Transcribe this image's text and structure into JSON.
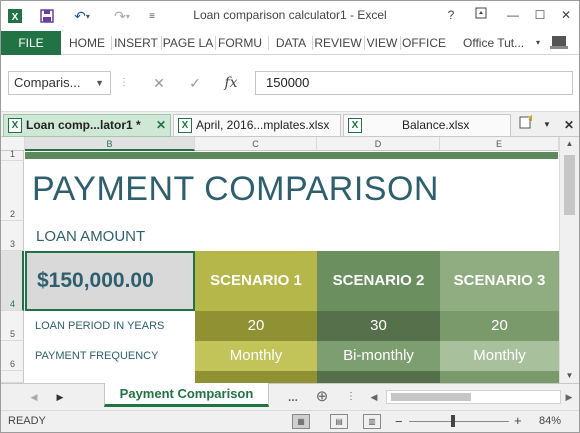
{
  "app": {
    "title": "Loan comparison calculator1 - Excel",
    "qat": {
      "save": "save-icon",
      "undo": "undo-icon",
      "redo": "redo-icon"
    },
    "window_buttons": {
      "help": "?",
      "restore_ribbon": "ribbon-icon",
      "minimize": "minimize-icon",
      "maximize": "maximize-icon",
      "close": "close-icon"
    }
  },
  "ribbon": {
    "file": "FILE",
    "tabs": [
      "HOME",
      "INSERT",
      "PAGE LA",
      "FORMU",
      "DATA",
      "REVIEW",
      "VIEW",
      "OFFICE"
    ],
    "account": "Office Tut..."
  },
  "formula_bar": {
    "name_box": "Comparis...",
    "fx": "fx",
    "value": "150000"
  },
  "workbooks": [
    {
      "label": "Loan comp...lator1 *",
      "active": true
    },
    {
      "label": "April, 2016...mplates.xlsx",
      "active": false
    },
    {
      "label": "Balance.xlsx",
      "active": false
    }
  ],
  "grid": {
    "columns": [
      "B",
      "C",
      "D",
      "E"
    ],
    "rows": [
      "1",
      "2",
      "3",
      "4",
      "5",
      "6"
    ],
    "title": "PAYMENT COMPARISON",
    "subtitle": "LOAN AMOUNT",
    "amount": "$150,000.00",
    "scenarios": [
      {
        "name": "SCENARIO 1",
        "loan_period": "20",
        "payment_frequency": "Monthly"
      },
      {
        "name": "SCENARIO 2",
        "loan_period": "30",
        "payment_frequency": "Bi-monthly"
      },
      {
        "name": "SCENARIO 3",
        "loan_period": "20",
        "payment_frequency": "Monthly"
      }
    ],
    "row_labels": {
      "loan_period": "LOAN PERIOD IN YEARS",
      "payment_frequency": "PAYMENT FREQUENCY"
    },
    "colors": {
      "scenario1_head": "#b5b74a",
      "scenario1_r5": "#8f9133",
      "scenario1_r6": "#c2c45a",
      "scenario2_head": "#6b8f5e",
      "scenario2_r5": "#55704b",
      "scenario2_r6": "#7d9e70",
      "scenario3_head": "#8fad80",
      "scenario3_r5": "#7a9a6c",
      "scenario3_r6": "#a8c09c",
      "title_text": "#2e5f6e",
      "header_band": "#5d8a5d"
    }
  },
  "sheets": {
    "active": "Payment Comparison",
    "more": "..."
  },
  "status": {
    "ready": "READY",
    "zoom": "84%"
  }
}
